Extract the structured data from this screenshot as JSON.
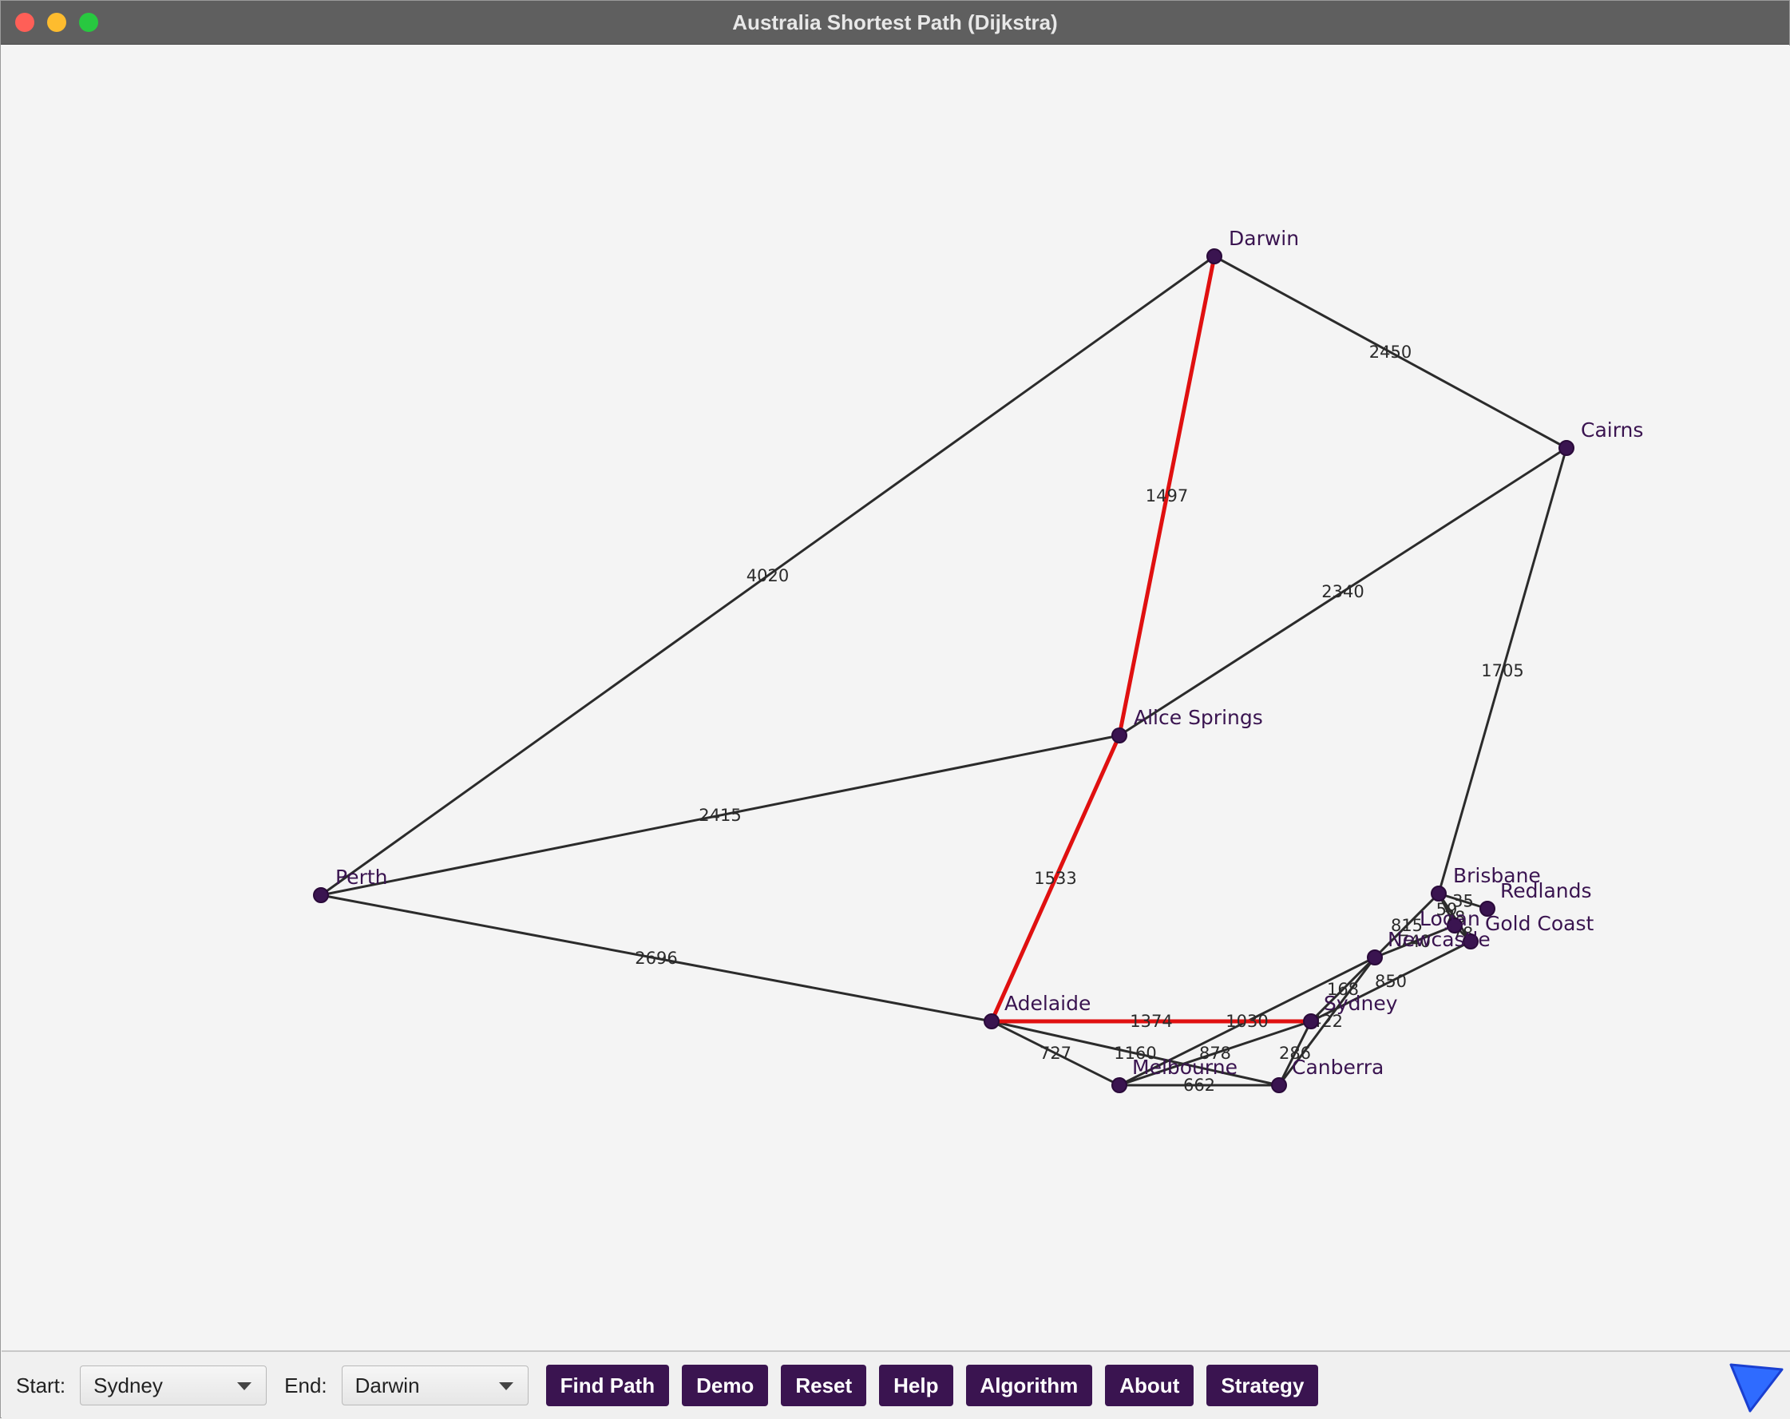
{
  "window": {
    "title": "Australia Shortest Path (Dijkstra)"
  },
  "colors": {
    "node": "#3a1450",
    "edge": "#2b2b2b",
    "path": "#e01010",
    "button": "#3a1450"
  },
  "graph": {
    "nodes": [
      {
        "id": "darwin",
        "label": "Darwin"
      },
      {
        "id": "cairns",
        "label": "Cairns"
      },
      {
        "id": "alice",
        "label": "Alice Springs"
      },
      {
        "id": "perth",
        "label": "Perth"
      },
      {
        "id": "brisbane",
        "label": "Brisbane"
      },
      {
        "id": "redlands",
        "label": "Redlands"
      },
      {
        "id": "logan",
        "label": "Logan"
      },
      {
        "id": "goldcoast",
        "label": "Gold Coast"
      },
      {
        "id": "newcastle",
        "label": "Newcastle"
      },
      {
        "id": "adelaide",
        "label": "Adelaide"
      },
      {
        "id": "sydney",
        "label": "Sydney"
      },
      {
        "id": "melbourne",
        "label": "Melbourne"
      },
      {
        "id": "canberra",
        "label": "Canberra"
      }
    ],
    "edges": [
      {
        "from": "darwin",
        "to": "cairns",
        "weight": "2450"
      },
      {
        "from": "darwin",
        "to": "perth",
        "weight": "4020"
      },
      {
        "from": "darwin",
        "to": "alice",
        "weight": "1497",
        "on_path": true
      },
      {
        "from": "alice",
        "to": "cairns",
        "weight": "2340"
      },
      {
        "from": "cairns",
        "to": "brisbane",
        "weight": "1705"
      },
      {
        "from": "perth",
        "to": "alice",
        "weight": "2415"
      },
      {
        "from": "perth",
        "to": "adelaide",
        "weight": "2696"
      },
      {
        "from": "alice",
        "to": "adelaide",
        "weight": "1533",
        "on_path": true
      },
      {
        "from": "adelaide",
        "to": "sydney",
        "weight": "1374",
        "on_path": true
      },
      {
        "from": "adelaide",
        "to": "melbourne",
        "weight": "727"
      },
      {
        "from": "adelaide",
        "to": "canberra",
        "weight": "1160"
      },
      {
        "from": "melbourne",
        "to": "sydney",
        "weight": "878"
      },
      {
        "from": "melbourne",
        "to": "canberra",
        "weight": "662"
      },
      {
        "from": "melbourne",
        "to": "newcastle",
        "weight": "1030"
      },
      {
        "from": "sydney",
        "to": "canberra",
        "weight": "286"
      },
      {
        "from": "sydney",
        "to": "newcastle",
        "weight": "168"
      },
      {
        "from": "canberra",
        "to": "newcastle",
        "weight": "422"
      },
      {
        "from": "newcastle",
        "to": "brisbane",
        "weight": "815"
      },
      {
        "from": "sydney",
        "to": "goldcoast",
        "weight": "850"
      },
      {
        "from": "newcastle",
        "to": "logan",
        "weight": "740"
      },
      {
        "from": "brisbane",
        "to": "redlands",
        "weight": "35"
      },
      {
        "from": "brisbane",
        "to": "logan",
        "weight": "59"
      },
      {
        "from": "logan",
        "to": "goldcoast",
        "weight": "78"
      },
      {
        "from": "brisbane",
        "to": "goldcoast",
        "weight": "78"
      }
    ]
  },
  "toolbar": {
    "start_label": "Start:",
    "start_value": "Sydney",
    "end_label": "End:",
    "end_value": "Darwin",
    "buttons": [
      "Find Path",
      "Demo",
      "Reset",
      "Help",
      "Algorithm",
      "About",
      "Strategy"
    ]
  }
}
